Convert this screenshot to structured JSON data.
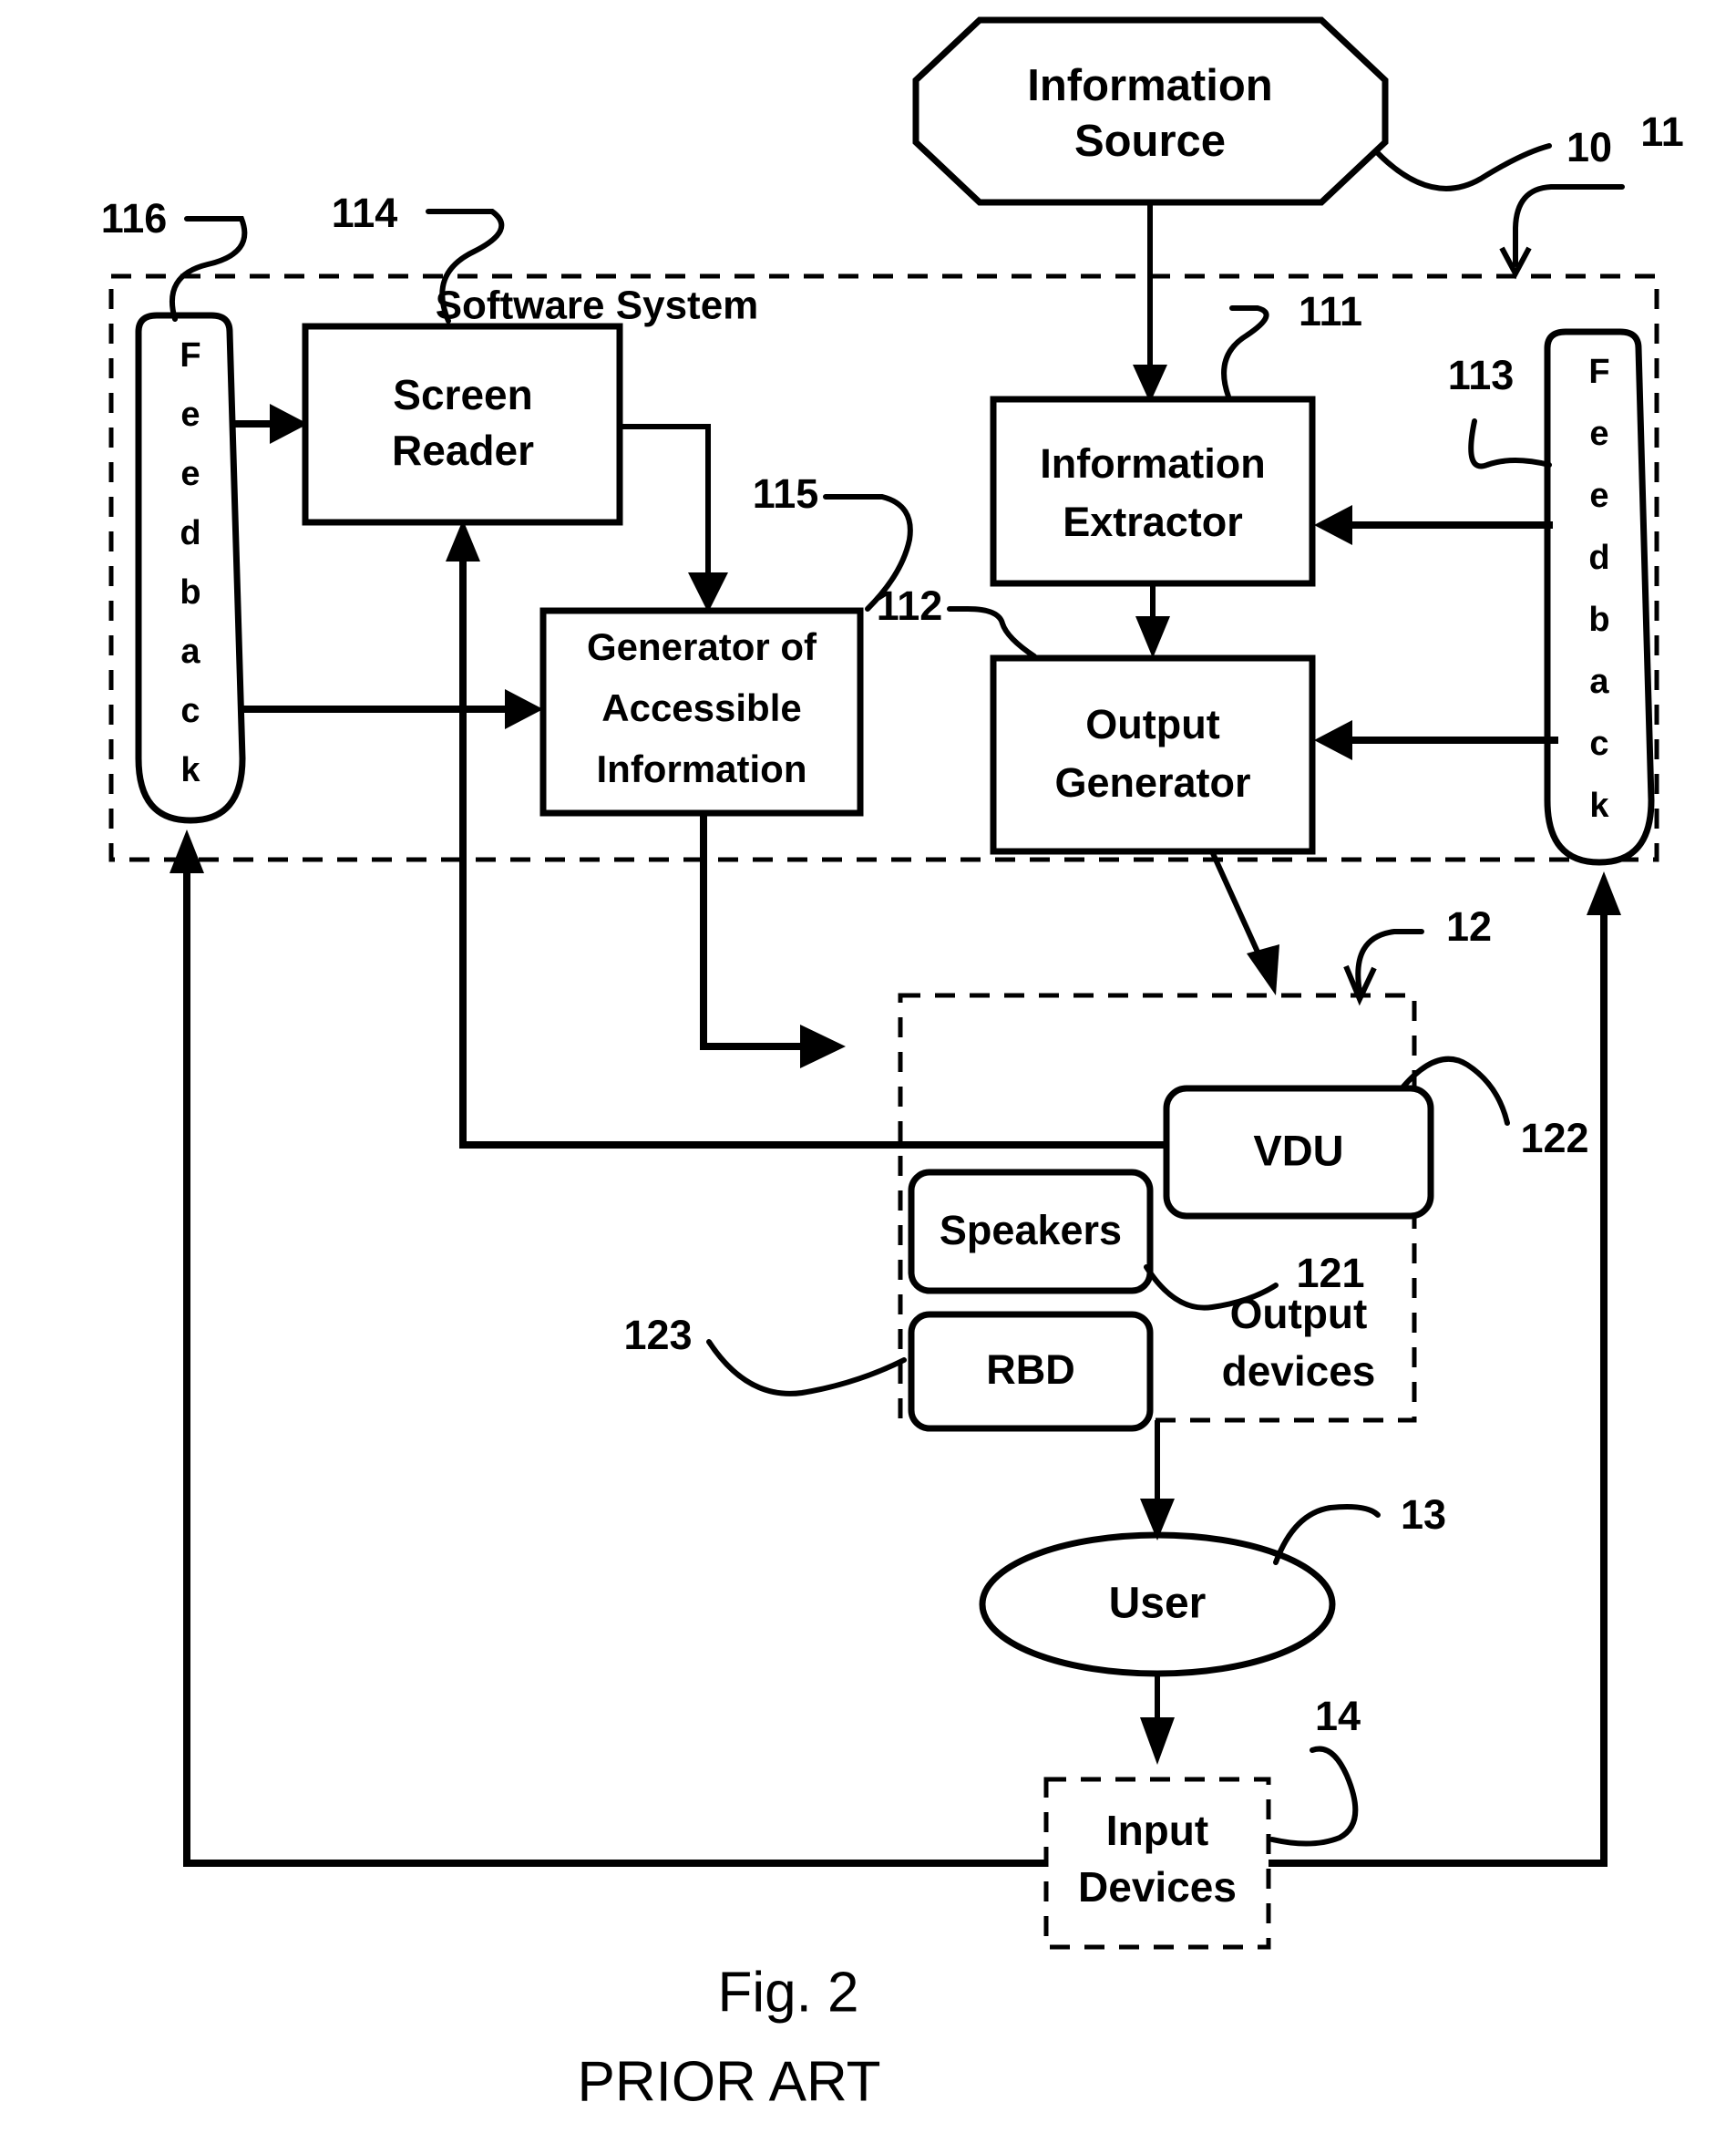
{
  "figure": {
    "caption": "Fig. 2",
    "subcaption": "PRIOR ART"
  },
  "nodes": {
    "information_source": {
      "label_line1": "Information",
      "label_line2": "Source",
      "ref": "10"
    },
    "software_system": {
      "label": "Software   System",
      "ref": "11"
    },
    "screen_reader": {
      "label_line1": "Screen",
      "label_line2": "Reader",
      "ref": "114"
    },
    "generator_accessible_info": {
      "label_line1": "Generator of",
      "label_line2": "Accessible",
      "label_line3": "Information",
      "ref": "115"
    },
    "information_extractor": {
      "label_line1": "Information",
      "label_line2": "Extractor",
      "ref": "111"
    },
    "output_generator": {
      "label_line1": "Output",
      "label_line2": "Generator",
      "ref": "112"
    },
    "feedback_left": {
      "letters": [
        "F",
        "e",
        "e",
        "d",
        "b",
        "a",
        "c",
        "k"
      ],
      "ref": "116"
    },
    "feedback_right": {
      "letters": [
        "F",
        "e",
        "e",
        "d",
        "b",
        "a",
        "c",
        "k"
      ],
      "ref": "113"
    },
    "output_devices": {
      "label_line1": "Output",
      "label_line2": "devices",
      "ref": "12"
    },
    "vdu": {
      "label": "VDU",
      "ref": "122"
    },
    "speakers": {
      "label": "Speakers",
      "ref": "121"
    },
    "rbd": {
      "label": "RBD",
      "ref": "123"
    },
    "user": {
      "label": "User",
      "ref": "13"
    },
    "input_devices": {
      "label_line1": "Input",
      "label_line2": "Devices",
      "ref": "14"
    }
  },
  "colors": {
    "stroke": "#000000",
    "fill": "#ffffff"
  }
}
